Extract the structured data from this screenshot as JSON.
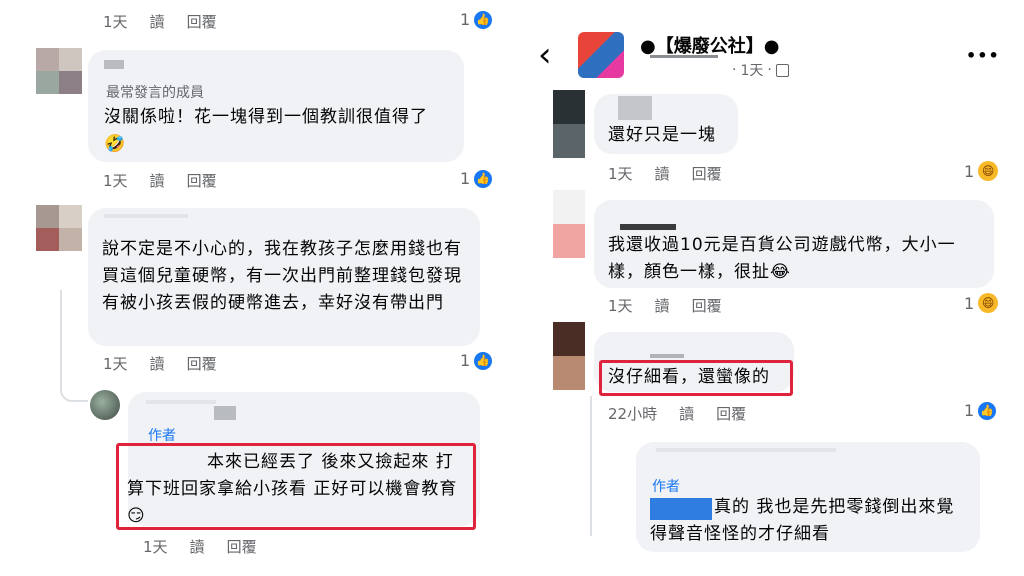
{
  "left": {
    "c0": {
      "time": "1天",
      "read": "讀",
      "reply": "回覆",
      "count": "1"
    },
    "c1": {
      "badge": "最常發言的成員",
      "text": "沒關係啦！花一塊得到一個教訓很值得了",
      "emoji": "🤣",
      "time": "1天",
      "read": "讀",
      "reply": "回覆",
      "count": "1"
    },
    "c2": {
      "text": "說不定是不小心的，我在教孩子怎麼用錢也有買這個兒童硬幣，有一次出門前整理錢包發現有被小孩丟假的硬幣進去，幸好沒有帶出門",
      "time": "1天",
      "read": "讀",
      "reply": "回覆",
      "count": "1"
    },
    "c3": {
      "author": "作者",
      "text": "本來已經丟了 後來又撿起來 打算下班回家拿給小孩看 正好可以機會教育",
      "emoji": "😏",
      "time": "1天",
      "read": "讀",
      "reply": "回覆"
    }
  },
  "right": {
    "header": {
      "back": "‹",
      "title": "●【爆廢公社】●",
      "time": "1天",
      "more": "•••"
    },
    "c1": {
      "text": "還好只是一塊",
      "time": "1天",
      "read": "讀",
      "reply": "回覆",
      "count": "1"
    },
    "c2": {
      "text": "我還收過10元是百貨公司遊戲代幣，大小一樣，顏色一樣，很扯",
      "emoji": "😂",
      "time": "1天",
      "read": "讀",
      "reply": "回覆",
      "count": "1"
    },
    "c3": {
      "text": "沒仔細看，還蠻像的",
      "time": "22小時",
      "read": "讀",
      "reply": "回覆",
      "count": "1"
    },
    "c4": {
      "author": "作者",
      "text": "真的 我也是先把零錢倒出來覺得聲音怪怪的才仔細看"
    }
  },
  "colors": {
    "bubble": "#f0f2f5",
    "highlight": "#e0233c",
    "like": "#1877f2"
  }
}
